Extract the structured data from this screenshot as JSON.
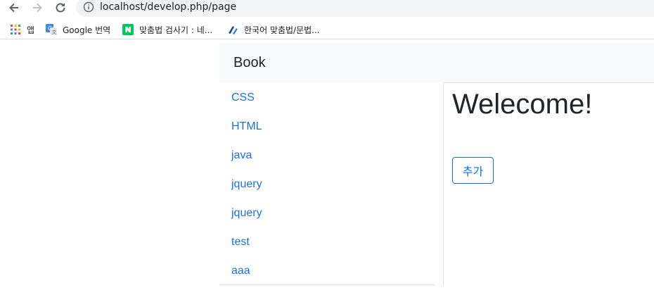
{
  "browser": {
    "url": "localhost/develop.php/page",
    "bookmarks": [
      {
        "label": "앱",
        "icon": "apps-grid-icon"
      },
      {
        "label": "Google 번역",
        "icon": "google-translate-icon"
      },
      {
        "label": "맞춤법 검사기 : 네...",
        "icon": "naver-icon"
      },
      {
        "label": "한국어 맞춤법/문법...",
        "icon": "spellcheck-icon"
      }
    ]
  },
  "navbar": {
    "brand": "Book"
  },
  "list": {
    "items": [
      "CSS",
      "HTML",
      "java",
      "jquery",
      "jquery",
      "test",
      "aaa"
    ]
  },
  "main": {
    "heading": "Welecome!",
    "add_button": "추가"
  },
  "colors": {
    "link": "#1f6fe0",
    "primary": "#0d6efd",
    "navbar_bg": "#f8f9fa",
    "text": "#212529"
  }
}
